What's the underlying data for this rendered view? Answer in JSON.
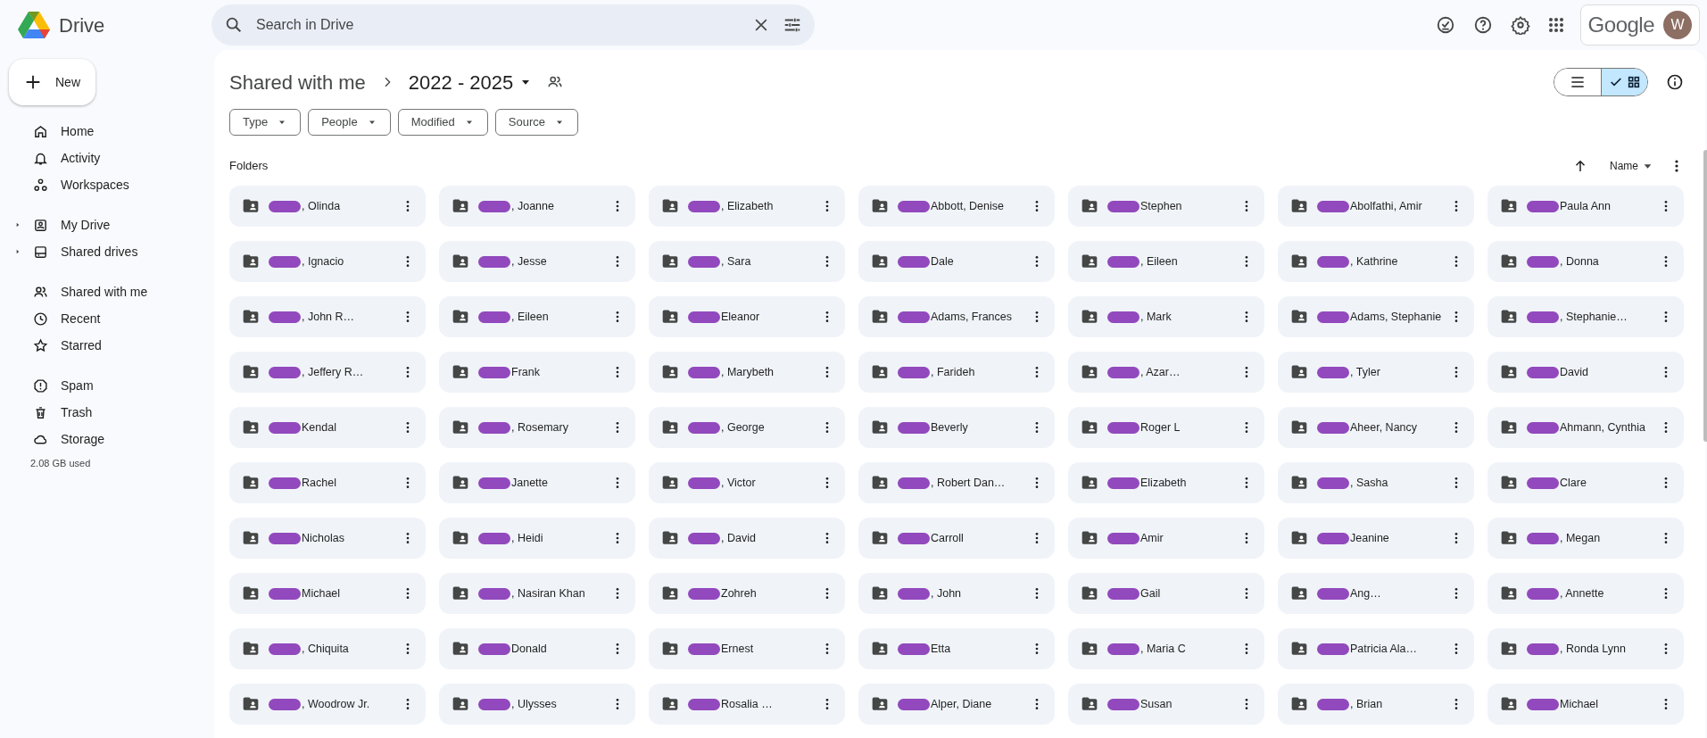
{
  "app": {
    "name": "Drive"
  },
  "search": {
    "placeholder": "Search in Drive"
  },
  "account": {
    "brand": "Google",
    "avatar_letter": "W"
  },
  "new_button": {
    "label": "New"
  },
  "sidebar": {
    "groups": [
      [
        {
          "label": "Home",
          "selected": false
        },
        {
          "label": "Activity",
          "selected": false
        },
        {
          "label": "Workspaces",
          "selected": false
        }
      ],
      [
        {
          "label": "My Drive",
          "selected": false,
          "expandable": true
        },
        {
          "label": "Shared drives",
          "selected": false,
          "expandable": true
        }
      ],
      [
        {
          "label": "Shared with me",
          "selected": false
        },
        {
          "label": "Recent",
          "selected": false
        },
        {
          "label": "Starred",
          "selected": false
        }
      ],
      [
        {
          "label": "Spam",
          "selected": false
        },
        {
          "label": "Trash",
          "selected": false
        },
        {
          "label": "Storage",
          "selected": false
        }
      ]
    ],
    "storage_used": "2.08 GB used"
  },
  "breadcrumb": {
    "parent": "Shared with me",
    "current": "2022 - 2025"
  },
  "view_toggle": [
    {
      "kind": "list",
      "selected": false
    },
    {
      "kind": "grid",
      "selected": true
    }
  ],
  "filters": [
    "Type",
    "People",
    "Modified",
    "Source"
  ],
  "section_title": "Folders",
  "sort": {
    "label": "Name"
  },
  "folders": [
    {
      "label": ", Olinda",
      "redacted": true
    },
    {
      "label": ", Joanne",
      "redacted": true
    },
    {
      "label": ", Elizabeth",
      "redacted": true
    },
    {
      "label": "Abbott, Denise",
      "redacted": true
    },
    {
      "label": "Stephen",
      "redacted": true
    },
    {
      "label": "Abolfathi, Amir",
      "redacted": true
    },
    {
      "label": "Paula Ann",
      "redacted": true
    },
    {
      "label": ", Ignacio",
      "redacted": true
    },
    {
      "label": ", Jesse",
      "redacted": true
    },
    {
      "label": ", Sara",
      "redacted": true
    },
    {
      "label": "Dale",
      "redacted": true
    },
    {
      "label": ", Eileen",
      "redacted": true
    },
    {
      "label": ", Kathrine",
      "redacted": true
    },
    {
      "label": ", Donna",
      "redacted": true
    },
    {
      "label": ", John R…",
      "redacted": true
    },
    {
      "label": ", Eileen",
      "redacted": true
    },
    {
      "label": "Eleanor",
      "redacted": true
    },
    {
      "label": "Adams, Frances",
      "redacted": true
    },
    {
      "label": ", Mark",
      "redacted": true
    },
    {
      "label": "Adams, Stephanie",
      "redacted": true
    },
    {
      "label": ", Stephanie…",
      "redacted": true
    },
    {
      "label": ", Jeffery R…",
      "redacted": true
    },
    {
      "label": "Frank",
      "redacted": true
    },
    {
      "label": ", Marybeth",
      "redacted": true
    },
    {
      "label": ", Farideh",
      "redacted": true
    },
    {
      "label": ", Azar…",
      "redacted": true
    },
    {
      "label": ", Tyler",
      "redacted": true
    },
    {
      "label": "David",
      "redacted": true
    },
    {
      "label": "Kendal",
      "redacted": true
    },
    {
      "label": ", Rosemary",
      "redacted": true
    },
    {
      "label": ", George",
      "redacted": true
    },
    {
      "label": "Beverly",
      "redacted": true
    },
    {
      "label": "Roger L",
      "redacted": true
    },
    {
      "label": "Aheer, Nancy",
      "redacted": true
    },
    {
      "label": "Ahmann, Cynthia",
      "redacted": true
    },
    {
      "label": "Rachel",
      "redacted": true
    },
    {
      "label": "Janette",
      "redacted": true
    },
    {
      "label": ", Victor",
      "redacted": true
    },
    {
      "label": ", Robert Dan…",
      "redacted": true
    },
    {
      "label": "Elizabeth",
      "redacted": true
    },
    {
      "label": ", Sasha",
      "redacted": true
    },
    {
      "label": "Clare",
      "redacted": true
    },
    {
      "label": "Nicholas",
      "redacted": true
    },
    {
      "label": ", Heidi",
      "redacted": true
    },
    {
      "label": ", David",
      "redacted": true
    },
    {
      "label": "Carroll",
      "redacted": true
    },
    {
      "label": "Amir",
      "redacted": true
    },
    {
      "label": "Jeanine",
      "redacted": true
    },
    {
      "label": ", Megan",
      "redacted": true
    },
    {
      "label": "Michael",
      "redacted": true
    },
    {
      "label": ", Nasiran Khan",
      "redacted": true
    },
    {
      "label": "Zohreh",
      "redacted": true
    },
    {
      "label": ", John",
      "redacted": true
    },
    {
      "label": "Gail",
      "redacted": true
    },
    {
      "label": "Ang…",
      "redacted": true
    },
    {
      "label": ", Annette",
      "redacted": true
    },
    {
      "label": ", Chiquita",
      "redacted": true
    },
    {
      "label": "Donald",
      "redacted": true
    },
    {
      "label": "Ernest",
      "redacted": true
    },
    {
      "label": "Etta",
      "redacted": true
    },
    {
      "label": ", Maria C",
      "redacted": true
    },
    {
      "label": "Patricia Ala…",
      "redacted": true
    },
    {
      "label": ", Ronda Lynn",
      "redacted": true
    },
    {
      "label": ", Woodrow Jr.",
      "redacted": true
    },
    {
      "label": ", Ulysses",
      "redacted": true
    },
    {
      "label": "Rosalia …",
      "redacted": true
    },
    {
      "label": "Alper, Diane",
      "redacted": true
    },
    {
      "label": "Susan",
      "redacted": true
    },
    {
      "label": ", Brian",
      "redacted": true
    },
    {
      "label": "Michael",
      "redacted": true
    }
  ]
}
